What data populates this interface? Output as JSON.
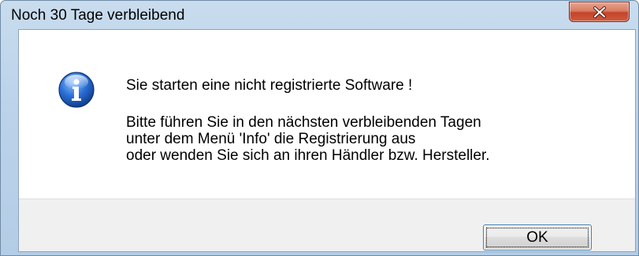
{
  "window": {
    "title": "Noch 30 Tage verbleibend",
    "close_icon": "close-x-icon"
  },
  "message": {
    "icon": "info-icon",
    "line1": "Sie starten eine nicht registrierte Software !",
    "line2": "Bitte führen Sie in den nächsten verbleibenden Tagen",
    "line3": "unter dem Menü 'Info' die Registrierung aus",
    "line4": "oder wenden Sie sich an ihren Händler bzw. Hersteller."
  },
  "buttons": {
    "ok_label": "OK"
  },
  "colors": {
    "titlebar": "#bcd3ea",
    "close_button": "#c4442a",
    "info_icon": "#1f5fbf",
    "footer": "#f0f0f0",
    "ok_border": "#3c7fb1"
  }
}
